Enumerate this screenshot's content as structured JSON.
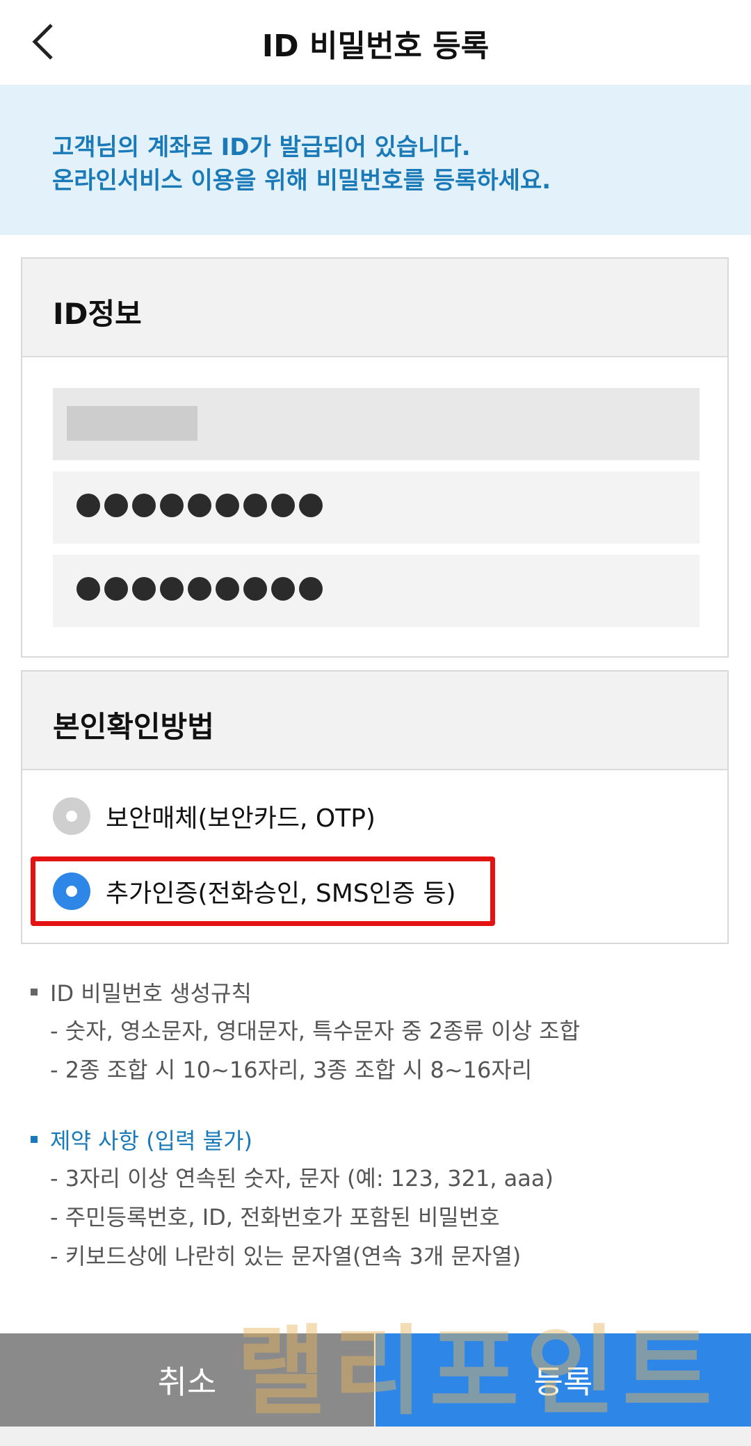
{
  "header": {
    "title": "ID 비밀번호 등록"
  },
  "notice": {
    "line1": "고객님의 계좌로 ID가 발급되어 있습니다.",
    "line2": "온라인서비스 이용을 위해 비밀번호를 등록하세요."
  },
  "id_info": {
    "title": "ID정보",
    "id_value": "",
    "password_mask": "●●●●●●●●●",
    "confirm_mask": "●●●●●●●●●"
  },
  "auth_method": {
    "title": "본인확인방법",
    "options": [
      {
        "label": "보안매체(보안카드, OTP)",
        "selected": false
      },
      {
        "label": "추가인증(전화승인, SMS인증 등)",
        "selected": true
      }
    ]
  },
  "rules": {
    "title": "ID 비밀번호 생성규칙",
    "items": [
      "- 숫자, 영소문자, 영대문자, 특수문자 중 2종류 이상 조합",
      "- 2종 조합 시 10~16자리, 3종 조합 시 8~16자리"
    ]
  },
  "restrictions": {
    "title": "제약 사항 (입력 불가)",
    "items": [
      "- 3자리 이상 연속된 숫자, 문자 (예: 123, 321, aaa)",
      "- 주민등록번호, ID, 전화번호가 포함된 비밀번호",
      "- 키보드상에 나란히 있는 문자열(연속 3개 문자열)"
    ]
  },
  "buttons": {
    "cancel": "취소",
    "register": "등록"
  },
  "watermark": "랠리포인트",
  "colors": {
    "accent": "#2e87e6",
    "notice_text": "#1a7ab8",
    "highlight": "#e41313",
    "cancel_bg": "#8a8a8a"
  }
}
